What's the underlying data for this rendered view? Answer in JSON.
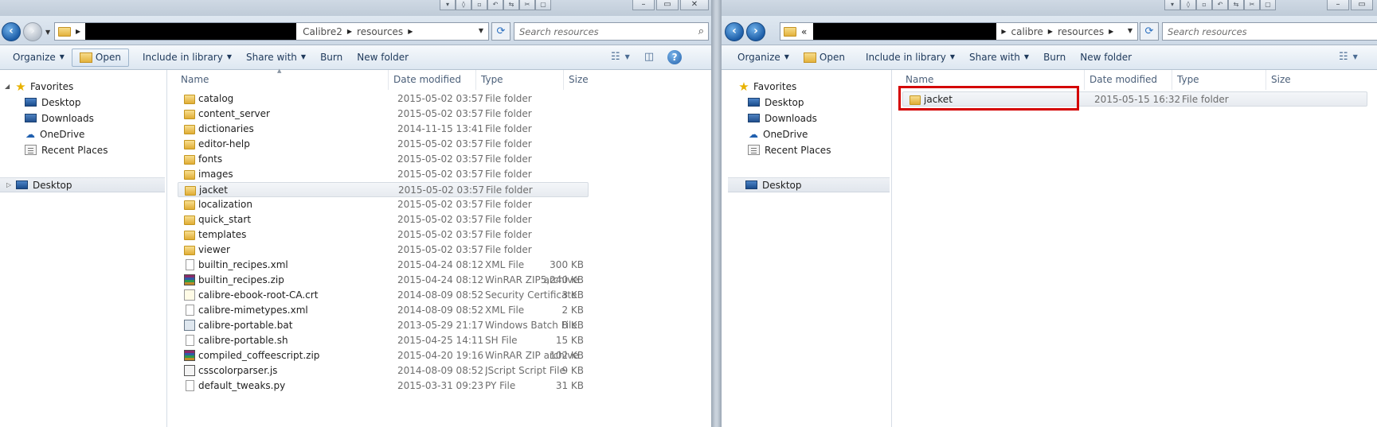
{
  "colors": {
    "accent": "#1e395b",
    "highlight": "#d40000",
    "folder": "#e3b23c"
  },
  "left": {
    "address": {
      "crumbs": [
        "Calibre2",
        "resources"
      ]
    },
    "search_placeholder": "Search resources",
    "toolbar": {
      "organize": "Organize",
      "open": "Open",
      "include": "Include in library",
      "share": "Share with",
      "burn": "Burn",
      "new_folder": "New folder"
    },
    "nav": {
      "favorites": "Favorites",
      "desktop": "Desktop",
      "downloads": "Downloads",
      "onedrive": "OneDrive",
      "recent": "Recent Places",
      "desktop_root": "Desktop"
    },
    "columns": {
      "name": "Name",
      "date": "Date modified",
      "type": "Type",
      "size": "Size"
    },
    "files": [
      {
        "name": "catalog",
        "date": "2015-05-02 03:57",
        "type": "File folder",
        "size": "",
        "icon": "folder-icon"
      },
      {
        "name": "content_server",
        "date": "2015-05-02 03:57",
        "type": "File folder",
        "size": "",
        "icon": "folder-icon"
      },
      {
        "name": "dictionaries",
        "date": "2014-11-15 13:41",
        "type": "File folder",
        "size": "",
        "icon": "folder-icon"
      },
      {
        "name": "editor-help",
        "date": "2015-05-02 03:57",
        "type": "File folder",
        "size": "",
        "icon": "folder-icon"
      },
      {
        "name": "fonts",
        "date": "2015-05-02 03:57",
        "type": "File folder",
        "size": "",
        "icon": "folder-icon"
      },
      {
        "name": "images",
        "date": "2015-05-02 03:57",
        "type": "File folder",
        "size": "",
        "icon": "folder-icon"
      },
      {
        "name": "jacket",
        "date": "2015-05-02 03:57",
        "type": "File folder",
        "size": "",
        "icon": "folder-icon",
        "selected": true
      },
      {
        "name": "localization",
        "date": "2015-05-02 03:57",
        "type": "File folder",
        "size": "",
        "icon": "folder-icon"
      },
      {
        "name": "quick_start",
        "date": "2015-05-02 03:57",
        "type": "File folder",
        "size": "",
        "icon": "folder-icon"
      },
      {
        "name": "templates",
        "date": "2015-05-02 03:57",
        "type": "File folder",
        "size": "",
        "icon": "folder-icon"
      },
      {
        "name": "viewer",
        "date": "2015-05-02 03:57",
        "type": "File folder",
        "size": "",
        "icon": "folder-icon"
      },
      {
        "name": "builtin_recipes.xml",
        "date": "2015-04-24 08:12",
        "type": "XML File",
        "size": "300 KB",
        "icon": "document-icon"
      },
      {
        "name": "builtin_recipes.zip",
        "date": "2015-04-24 08:12",
        "type": "WinRAR ZIP archive",
        "size": "5,240 KB",
        "icon": "archive-icon"
      },
      {
        "name": "calibre-ebook-root-CA.crt",
        "date": "2014-08-09 08:52",
        "type": "Security Certificate",
        "size": "3 KB",
        "icon": "certificate-icon"
      },
      {
        "name": "calibre-mimetypes.xml",
        "date": "2014-08-09 08:52",
        "type": "XML File",
        "size": "2 KB",
        "icon": "document-icon"
      },
      {
        "name": "calibre-portable.bat",
        "date": "2013-05-29 21:17",
        "type": "Windows Batch File",
        "size": "8 KB",
        "icon": "batch-file-icon"
      },
      {
        "name": "calibre-portable.sh",
        "date": "2015-04-25 14:11",
        "type": "SH File",
        "size": "15 KB",
        "icon": "document-icon"
      },
      {
        "name": "compiled_coffeescript.zip",
        "date": "2015-04-20 19:16",
        "type": "WinRAR ZIP archive",
        "size": "102 KB",
        "icon": "archive-icon"
      },
      {
        "name": "csscolorparser.js",
        "date": "2014-08-09 08:52",
        "type": "JScript Script File",
        "size": "9 KB",
        "icon": "script-icon"
      },
      {
        "name": "default_tweaks.py",
        "date": "2015-03-31 09:23",
        "type": "PY File",
        "size": "31 KB",
        "icon": "python-file-icon"
      }
    ]
  },
  "right": {
    "address": {
      "lead": "«",
      "crumbs": [
        "calibre",
        "resources"
      ]
    },
    "search_placeholder": "Search resources",
    "toolbar": {
      "organize": "Organize",
      "open": "Open",
      "include": "Include in library",
      "share": "Share with",
      "burn": "Burn",
      "new_folder": "New folder"
    },
    "nav": {
      "favorites": "Favorites",
      "desktop": "Desktop",
      "downloads": "Downloads",
      "onedrive": "OneDrive",
      "recent": "Recent Places",
      "desktop_root": "Desktop"
    },
    "columns": {
      "name": "Name",
      "date": "Date modified",
      "type": "Type",
      "size": "Size"
    },
    "files": [
      {
        "name": "jacket",
        "date": "2015-05-15 16:32",
        "type": "File folder",
        "size": "",
        "icon": "folder-icon",
        "selected": true
      }
    ]
  }
}
